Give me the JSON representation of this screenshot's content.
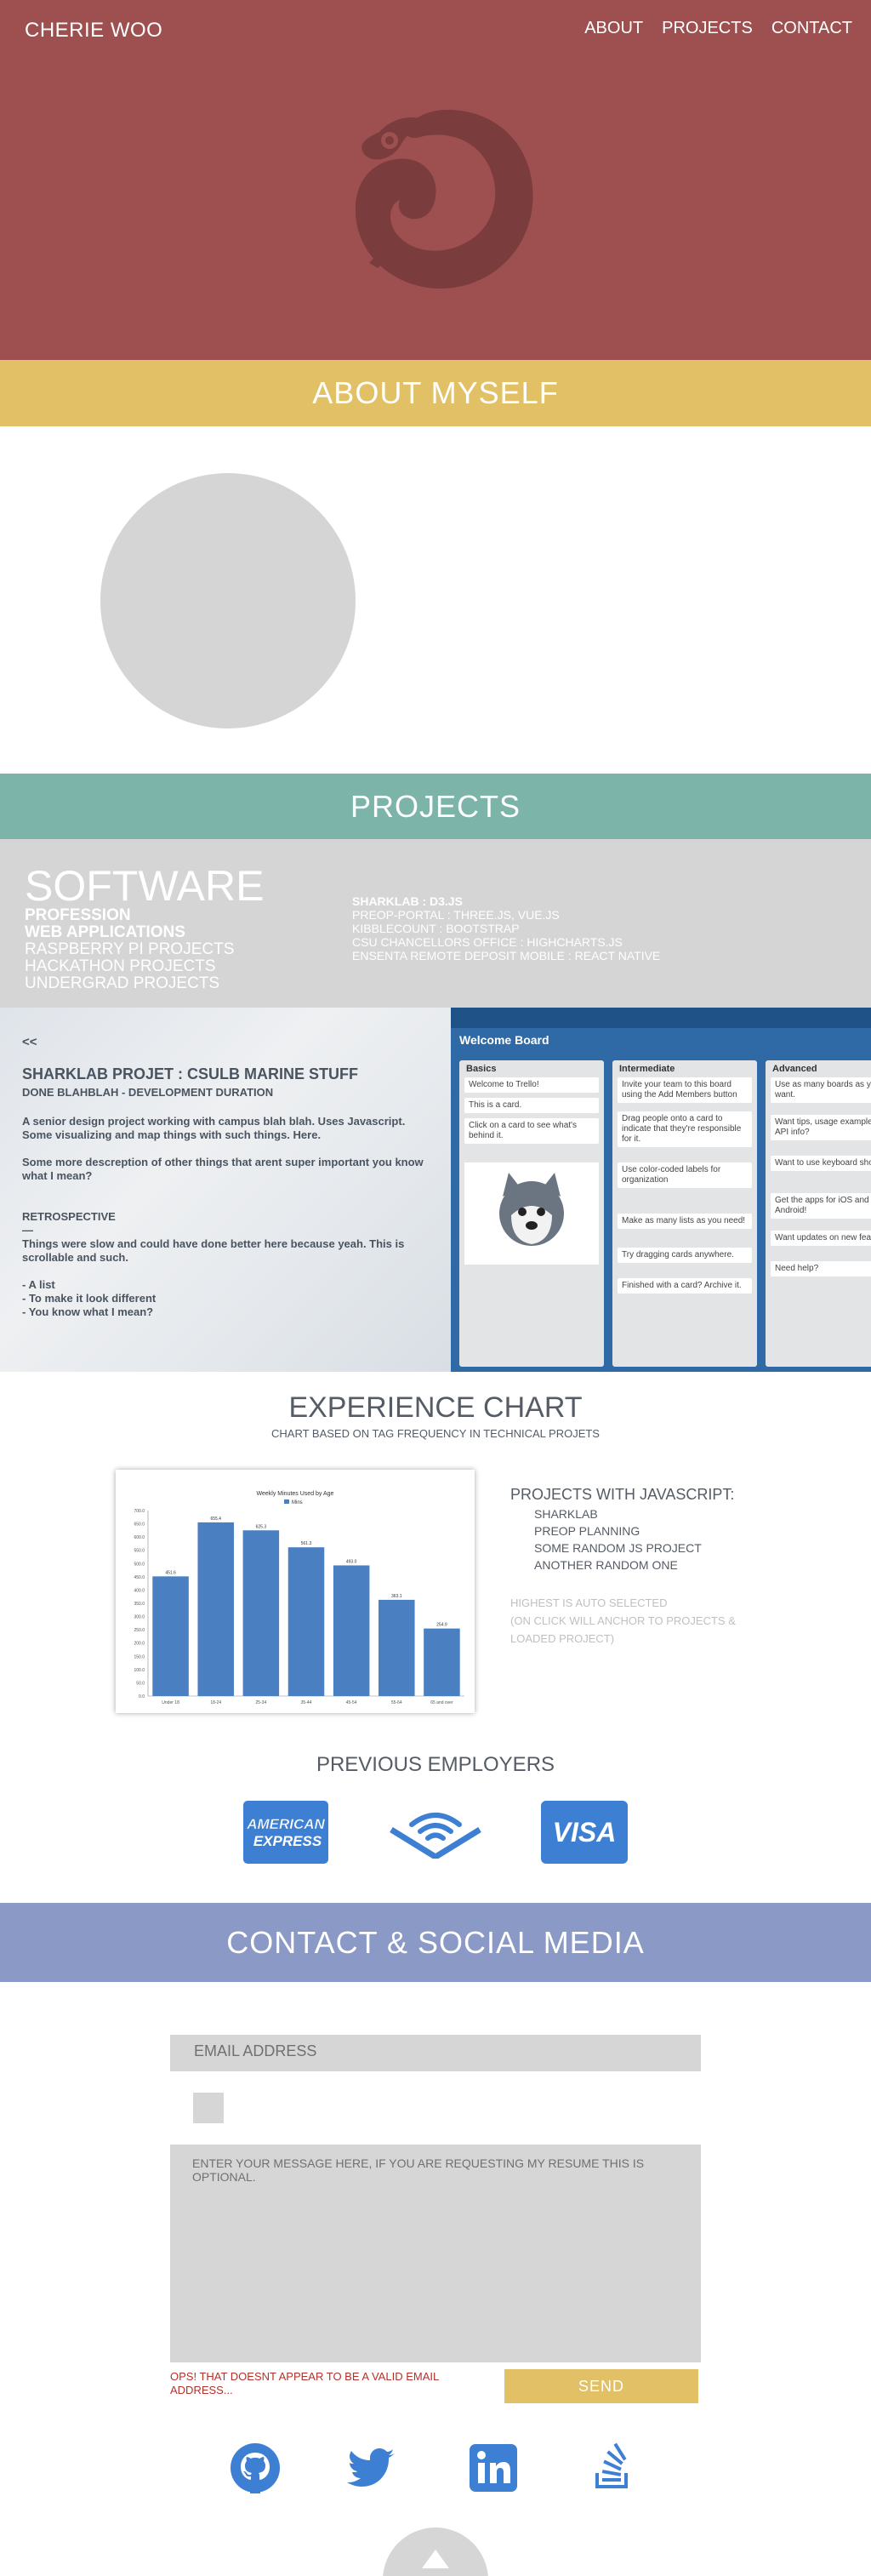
{
  "header": {
    "brand": "CHERIE WOO",
    "nav": [
      "ABOUT",
      "PROJECTS",
      "CONTACT"
    ]
  },
  "icons": {
    "hero": "chameleon-logo-icon",
    "social": [
      "github-icon",
      "twitter-icon",
      "linkedin-icon",
      "stackoverflow-icon"
    ],
    "scroll": "arrow-up-icon"
  },
  "colors": {
    "hero_bg": "#9e5050",
    "accent_yellow": "#e1c066",
    "projects_teal": "#7db4a9",
    "contact_blue": "#8a99c5",
    "icon_blue": "#3d7fd3",
    "error_red": "#b3312b"
  },
  "sections": {
    "about": "ABOUT MYSELF",
    "projects": "PROJECTS",
    "contact": "CONTACT & SOCIAL MEDIA"
  },
  "software": {
    "title": "SOFTWARE",
    "categories": [
      "PROFESSION",
      "WEB APPLICATIONS",
      "RASPBERRY PI PROJECTS",
      "HACKATHON PROJECTS",
      "UNDERGRAD PROJECTS"
    ],
    "projects": [
      "SHARKLAB : D3.JS",
      "PREOP-PORTAL : THREE.JS, VUE.JS",
      "KIBBLECOUNT : BOOTSTRAP",
      "CSU CHANCELLORS OFFICE : HIGHCHARTS.JS",
      "ENSENTA REMOTE DEPOSIT MOBILE : REACT NATIVE"
    ]
  },
  "project_detail": {
    "back": "<<",
    "title": "SHARKLAB PROJET : CSULB MARINE STUFF",
    "subtitle": "DONE BLAHBLAH - DEVELOPMENT DURATION",
    "para1": "A senior design project working with campus blah blah. Uses Javascript. Some visualizing and map things with such things. Here.",
    "para2": "Some more descreption of other things that arent super important you know what I mean?",
    "retro_heading": "RETROSPECTIVE",
    "retro_dash": "—",
    "retro_text": "Things were slow and could have done better here because yeah. This is scrollable and such.",
    "list": [
      "- A list",
      "- To make it look different",
      "- You know what I mean?"
    ],
    "board": {
      "title": "Welcome Board",
      "columns": [
        {
          "name": "Basics",
          "cards": [
            "Welcome to Trello!",
            "This is a card.",
            "Click on a card to see what's behind it."
          ]
        },
        {
          "name": "Intermediate",
          "cards": [
            "Invite your team to this board using the Add Members button",
            "Drag people onto a card to indicate that they're responsible for it.",
            "Use color-coded labels for organization",
            "Make as many lists as you need!",
            "Try dragging cards anywhere.",
            "Finished with a card? Archive it."
          ]
        },
        {
          "name": "Advanced",
          "cards": [
            "Use as many boards as you want.",
            "Want tips, usage examples, or API info?",
            "Want to use keyboard shortcuts?",
            "Get the apps for iOS and Android!",
            "Want updates on new features?",
            "Need help?"
          ]
        }
      ]
    }
  },
  "experience": {
    "title": "EXPERIENCE CHART",
    "subtitle": "CHART BASED ON TAG FREQUENCY IN TECHNICAL PROJETS",
    "side_heading": "PROJECTS WITH JAVASCRIPT:",
    "side_items": [
      "SHARKLAB",
      "PREOP PLANNING",
      "SOME RANDOM JS PROJECT",
      "ANOTHER RANDOM ONE"
    ],
    "note_lines": [
      "HIGHEST IS AUTO SELECTED",
      "(ON CLICK WILL ANCHOR TO PROJECTS &",
      "LOADED PROJECT)"
    ]
  },
  "chart_data": {
    "type": "bar",
    "title": "Weekly Minutes Used by Age",
    "legend": "Mins",
    "categories": [
      "Under 18",
      "18-24",
      "25-34",
      "35-44",
      "45-54",
      "55-64",
      "65 and over"
    ],
    "values": [
      451.6,
      655.4,
      625.3,
      561.3,
      493.0,
      363.1,
      254.9
    ],
    "ylim": [
      0,
      700
    ],
    "yticks": [
      0,
      50,
      100,
      150,
      200,
      250,
      300,
      350,
      400,
      450,
      500,
      550,
      600,
      650,
      700
    ],
    "grid": false
  },
  "employers": {
    "title": "PREVIOUS EMPLOYERS",
    "amex_line1": "AMERICAN",
    "amex_line2": "EXPRESS",
    "visa": "VISA"
  },
  "contact": {
    "email_placeholder": "EMAIL ADDRESS",
    "message_placeholder": "ENTER YOUR MESSAGE HERE, IF YOU ARE REQUESTING MY RESUME THIS IS OPTIONAL.",
    "error": "OPS! THAT DOESNT APPEAR TO BE A VALID EMAIL ADDRESS...",
    "send": "SEND"
  }
}
